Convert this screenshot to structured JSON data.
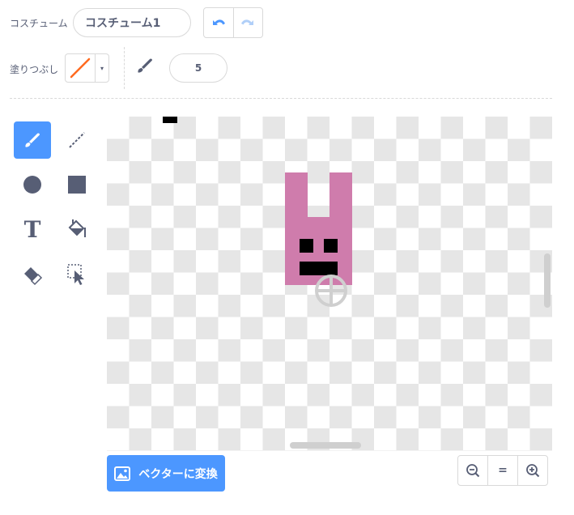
{
  "costume": {
    "label": "コスチューム",
    "name_value": "コスチューム1"
  },
  "history": {
    "undo_icon": "undo-arrow-icon",
    "redo_icon": "redo-arrow-icon"
  },
  "fill": {
    "label": "塗りつぶし",
    "color_icon": "no-fill-slash-icon",
    "dropdown_glyph": "▾"
  },
  "brush": {
    "icon": "brush-icon",
    "size_value": "5"
  },
  "tools": [
    {
      "name": "brush",
      "icon": "brush-icon",
      "active": true
    },
    {
      "name": "line",
      "icon": "line-icon",
      "active": false
    },
    {
      "name": "circle",
      "icon": "circle-icon",
      "active": false
    },
    {
      "name": "rectangle",
      "icon": "rectangle-icon",
      "active": false
    },
    {
      "name": "text",
      "icon": "text-icon",
      "active": false
    },
    {
      "name": "fill",
      "icon": "fill-bucket-icon",
      "active": false
    },
    {
      "name": "eraser",
      "icon": "eraser-icon",
      "active": false
    },
    {
      "name": "select",
      "icon": "select-icon",
      "active": false
    }
  ],
  "tool_glyphs": {
    "text": "T"
  },
  "colors": {
    "accent": "#4c97ff",
    "text": "#575e75",
    "sprite_pink": "#cf7cac",
    "sprite_black": "#000000",
    "tool_icon": "#575e75"
  },
  "convert": {
    "label": "ベクターに変換",
    "icon": "image-icon"
  },
  "zoom": {
    "zoom_out_icon": "zoom-out-icon",
    "reset_label": "=",
    "zoom_in_icon": "zoom-in-icon"
  }
}
